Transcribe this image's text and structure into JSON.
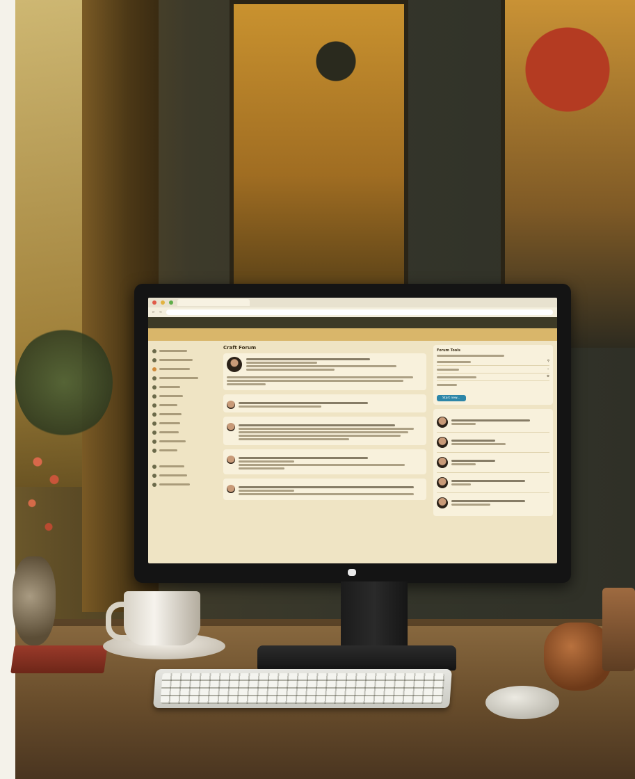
{
  "scene": {
    "description_free": true
  },
  "browser": {
    "tab_title": "",
    "url": "",
    "top_nav_text": "",
    "subnav_items": []
  },
  "page": {
    "heading": "Craft Forum"
  },
  "right_panel": {
    "panel1_title": "Forum Tools",
    "button_label": "Start new..."
  },
  "colors": {
    "accent": "#2d86a8",
    "nav_dark": "#3d3a26",
    "subnav": "#d9b66a",
    "screen_bg": "#efe4c4"
  }
}
